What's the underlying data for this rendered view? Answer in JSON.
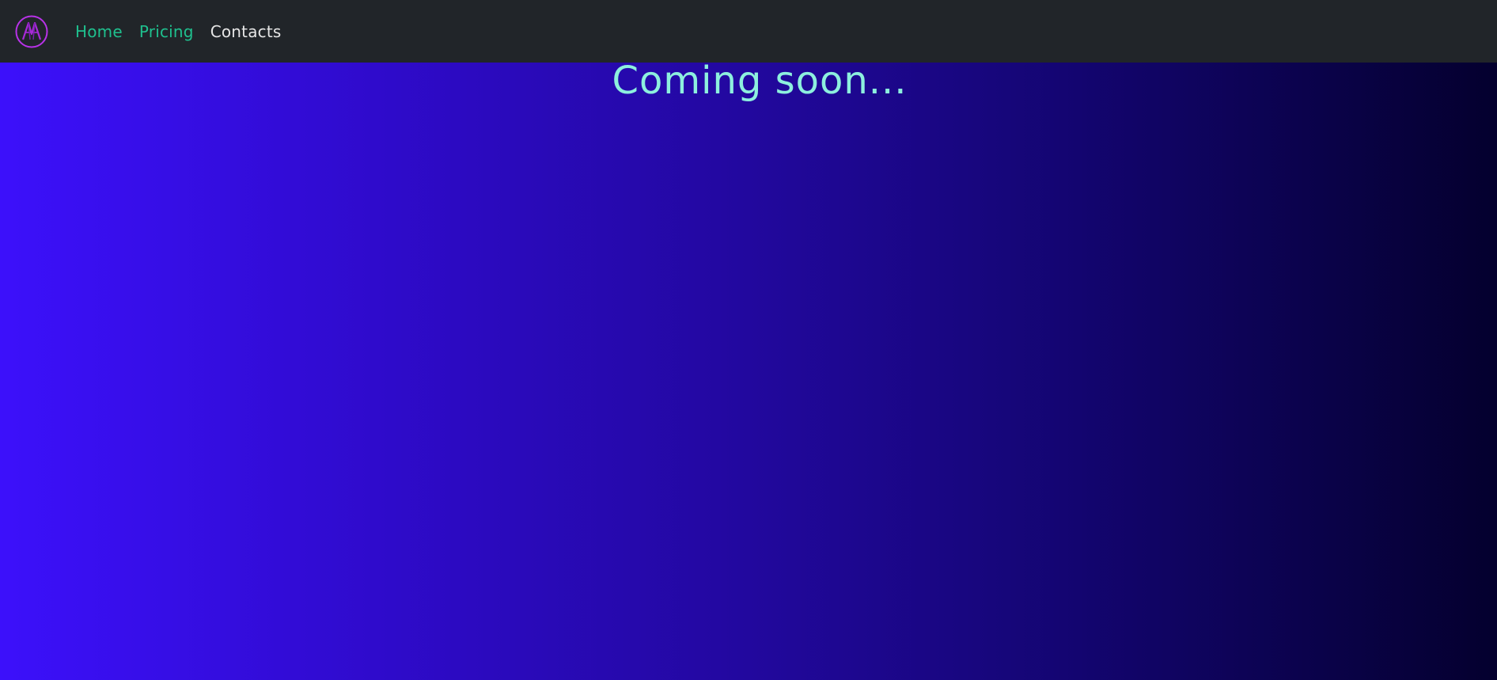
{
  "navbar": {
    "logo_icon": "brand-logo-icon",
    "links": [
      {
        "label": "Home"
      },
      {
        "label": "Pricing"
      },
      {
        "label": "Contacts"
      }
    ]
  },
  "main": {
    "headline": "Coming soon..."
  },
  "colors": {
    "navbar_bg": "#212529",
    "link_active": "#1fc08e",
    "link_default": "#e6e6e6",
    "headline": "#8df0de",
    "gradient_start": "#3c10fb",
    "gradient_end": "#04002e",
    "logo_stroke": "#b832e8"
  }
}
